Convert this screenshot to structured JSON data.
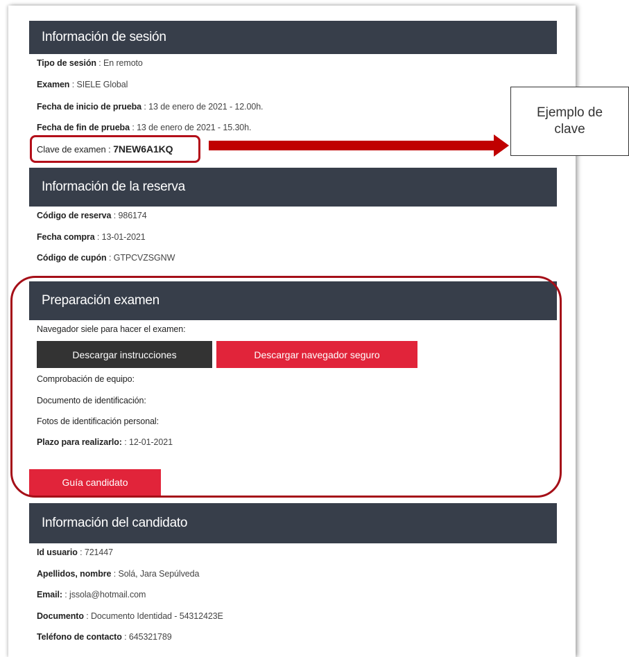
{
  "sections": {
    "session": {
      "title": "Información de sesión",
      "rows": [
        {
          "label": "Tipo de sesión",
          "value": " : En remoto"
        },
        {
          "label": "Examen",
          "value": " : SIELE Global"
        },
        {
          "label": "Fecha de inicio de prueba",
          "value": " : 13 de enero de 2021 - 12.00h."
        },
        {
          "label": "Fecha de fin de prueba",
          "value": " : 13 de enero de 2021 - 15.30h."
        }
      ],
      "key_label": "Clave de examen",
      "key_sep": " : ",
      "key_value": "7NEW6A1KQ"
    },
    "booking": {
      "title": "Información de la reserva",
      "rows": [
        {
          "label": "Código de reserva",
          "value": " : 986174"
        },
        {
          "label": "Fecha compra",
          "value": " : 13-01-2021"
        },
        {
          "label": "Código de cupón",
          "value": " : GTPCVZSGNW"
        }
      ]
    },
    "prep": {
      "title": "Preparación examen",
      "browser_label": "Navegador siele para hacer el examen:",
      "btn_instructions": "Descargar instrucciones",
      "btn_browser": "Descargar navegador seguro",
      "check_label": "Comprobación de equipo:",
      "id_doc_label": "Documento de identificación:",
      "photos_label": "Fotos de identificación personal:",
      "deadline_label": "Plazo para realizarlo:",
      "deadline_value": " : 12-01-2021",
      "btn_guide": "Guía candidato"
    },
    "candidate": {
      "title": "Información del candidato",
      "rows": [
        {
          "label": "Id usuario",
          "value": " : 721447"
        },
        {
          "label": "Apellidos, nombre",
          "value": " : Solá, Jara Sepúlveda"
        },
        {
          "label": "Email:",
          "value": " : jssola@hotmail.com"
        },
        {
          "label": "Documento",
          "value": " : Documento Identidad - 54312423E"
        },
        {
          "label": "Teléfono de contacto",
          "value": " : 645321789"
        }
      ]
    }
  },
  "annotation": {
    "callout_line1": "Ejemplo de",
    "callout_line2": "clave"
  },
  "colors": {
    "header_bg": "#373e4a",
    "accent_red": "#e1243a",
    "dark_button": "#333333",
    "annotation_red": "#c00000"
  }
}
